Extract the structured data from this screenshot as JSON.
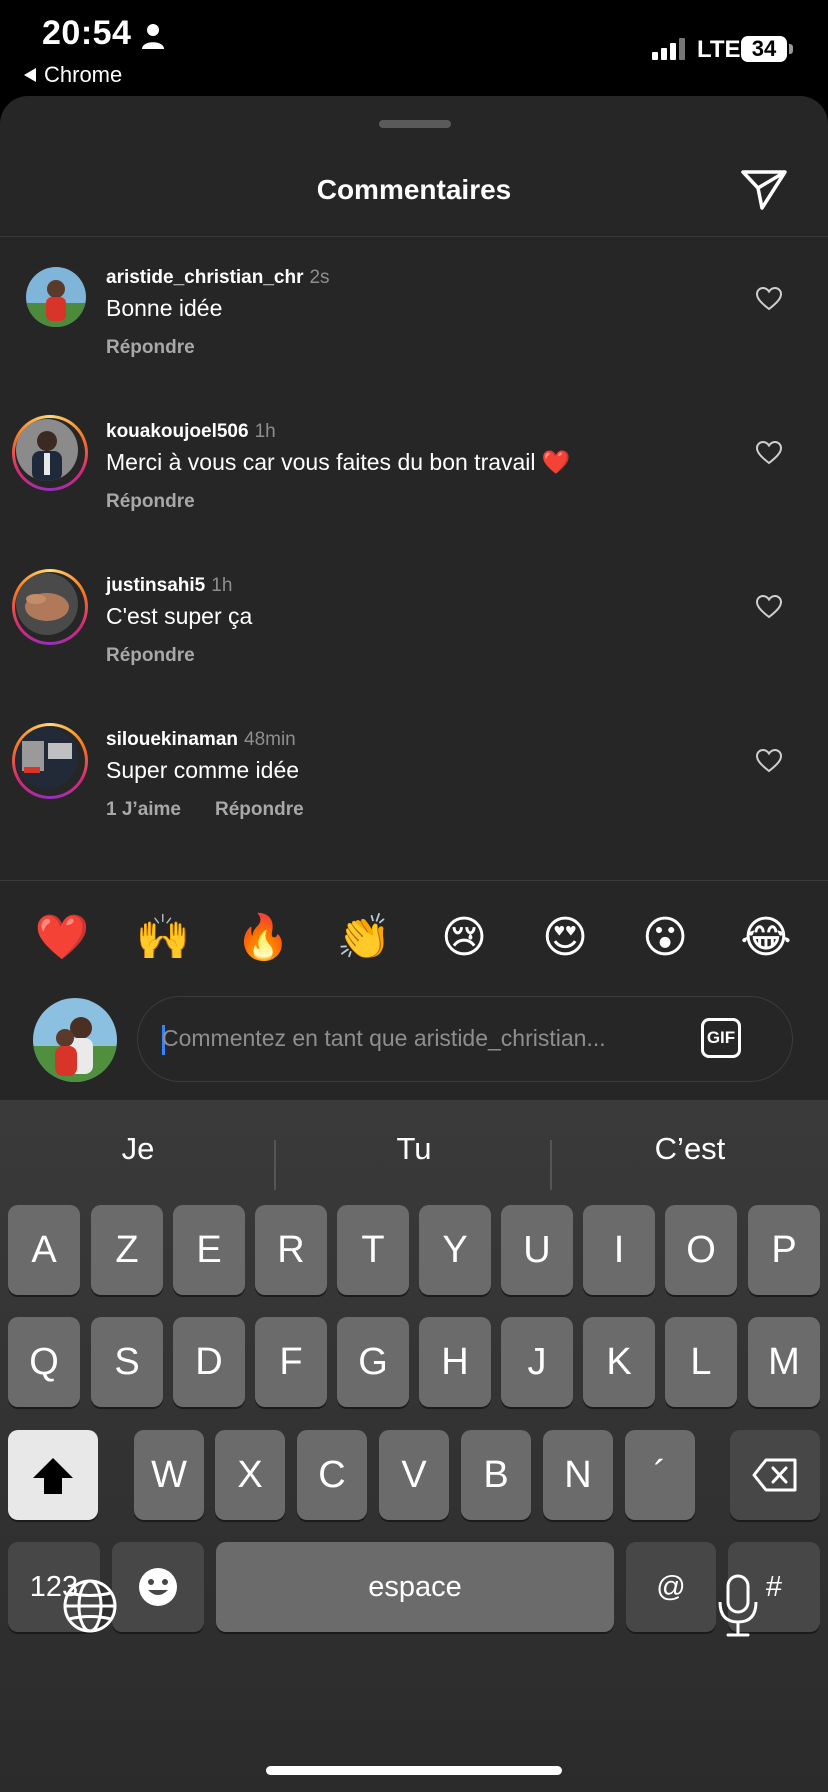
{
  "status": {
    "time": "20:54",
    "back_app": "Chrome",
    "network": "LTE",
    "battery": "34"
  },
  "sheet": {
    "title": "Commentaires"
  },
  "comments": [
    {
      "username": "aristide_christian_chr",
      "ago": "2s",
      "text": "Bonne idée",
      "likes": "",
      "reply": "Répondre"
    },
    {
      "username": "kouakoujoel506",
      "ago": "1h",
      "text": "Merci à vous car vous faites du bon travail ❤️",
      "likes": "",
      "reply": "Répondre"
    },
    {
      "username": "justinsahi5",
      "ago": "1h",
      "text": "C'est super ça",
      "likes": "",
      "reply": "Répondre"
    },
    {
      "username": "silouekinaman",
      "ago": "48min",
      "text": "Super comme idée",
      "likes": "1 J’aime",
      "reply": "Répondre"
    }
  ],
  "emojis": [
    "❤️",
    "🙌",
    "🔥",
    "👏",
    "😢",
    "😍",
    "😮",
    "😂"
  ],
  "composer": {
    "placeholder": "Commentez en tant que aristide_christian...",
    "gif": "GIF"
  },
  "keyboard": {
    "suggestions": [
      "Je",
      "Tu",
      "C’est"
    ],
    "row1": [
      "A",
      "Z",
      "E",
      "R",
      "T",
      "Y",
      "U",
      "I",
      "O",
      "P"
    ],
    "row2": [
      "Q",
      "S",
      "D",
      "F",
      "G",
      "H",
      "J",
      "K",
      "L",
      "M"
    ],
    "row3": [
      "W",
      "X",
      "C",
      "V",
      "B",
      "N",
      "´"
    ],
    "numbers": "123",
    "space": "espace",
    "at": "@",
    "hash": "#"
  }
}
